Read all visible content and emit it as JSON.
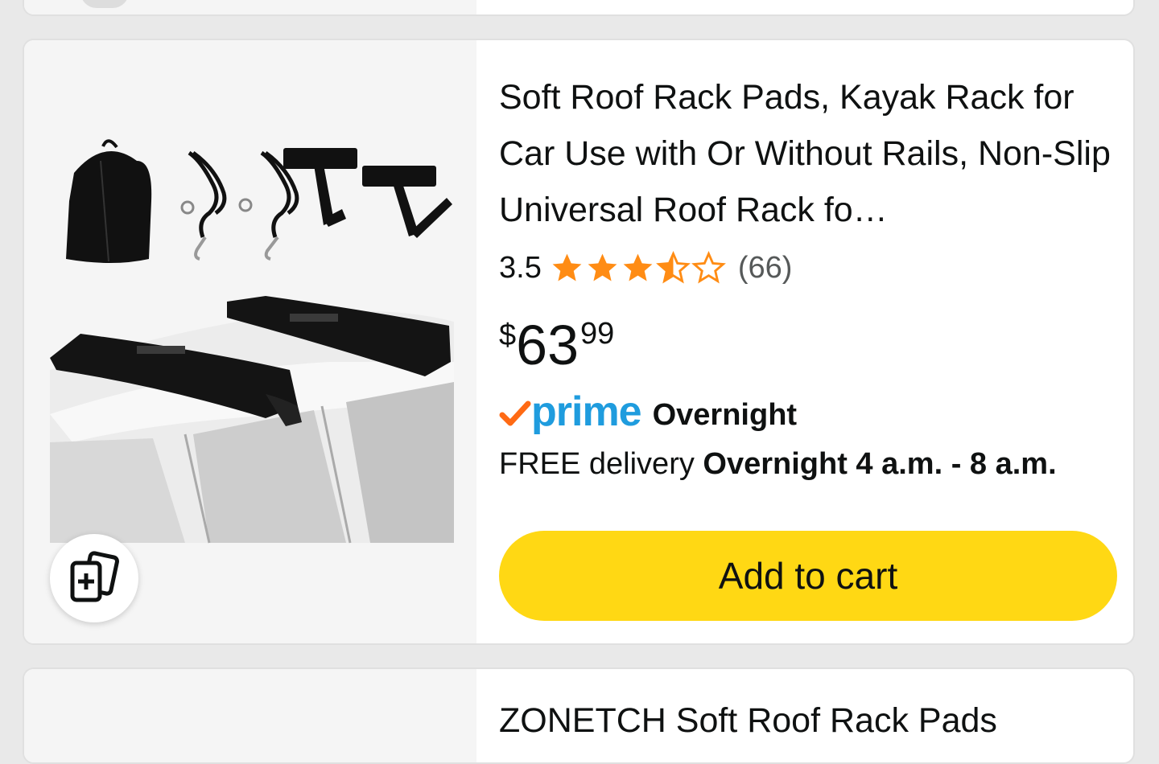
{
  "product": {
    "title": "Soft Roof Rack Pads, Kayak Rack for Car Use with Or Without Rails, Non-Slip Universal Roof Rack fo…",
    "rating": "3.5",
    "stars": 3.5,
    "review_count": "(66)",
    "price": {
      "symbol": "$",
      "whole": "63",
      "fraction": "99"
    },
    "prime_label": "prime",
    "prime_speed": "Overnight",
    "delivery_prefix": "FREE delivery ",
    "delivery_window": "Overnight 4 a.m. - 8 a.m.",
    "add_to_cart_label": "Add to cart",
    "image_icon": "product-image",
    "compare_icon": "add-to-compare-icon"
  },
  "next_product": {
    "title": "ZONETCH Soft Roof Rack Pads"
  },
  "colors": {
    "star": "#ff8c14",
    "prime_blue": "#1f9cde",
    "prime_check": "#ff9900",
    "cart_button": "#ffd814"
  }
}
